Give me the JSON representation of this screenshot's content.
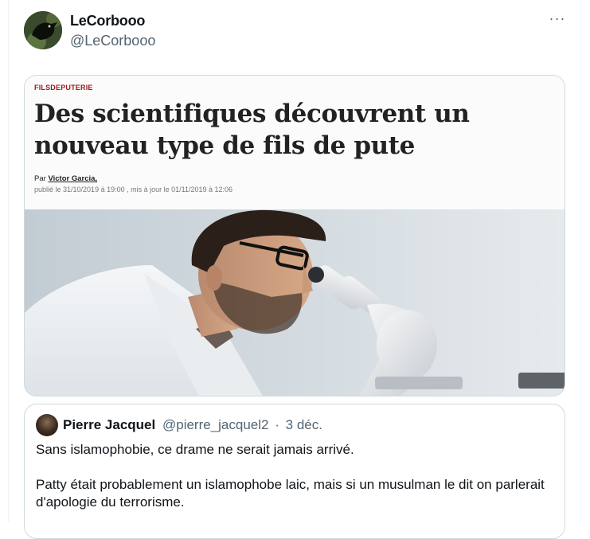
{
  "tweet": {
    "author_name": "LeCorbooo",
    "author_handle": "@LeCorbooo",
    "more_label": "···"
  },
  "article": {
    "category": "FILSDEPUTERIE",
    "title": "Des scientifiques découvrent un nouveau type de fils de pute",
    "byline_prefix": "Par",
    "byline_author": "Victor Garcia,",
    "dates": "publié le 31/10/2019 à 19:00 , mis à jour le 01/11/2019 à 12:06"
  },
  "quote": {
    "name": "Pierre Jacquel",
    "handle": "@pierre_jacquel2",
    "separator": "·",
    "date": "3 déc.",
    "paragraph_1": "Sans islamophobie, ce drame ne serait jamais arrivé.",
    "paragraph_2": "Patty était probablement un islamophobe laic, mais si un musulman le dit on parlerait d'apologie du terrorisme."
  },
  "colors": {
    "text_primary": "#0f1419",
    "text_secondary": "#536471",
    "border": "#cfd9de",
    "category_red": "#9b1b1b"
  },
  "icons": [
    "more-options-icon"
  ]
}
